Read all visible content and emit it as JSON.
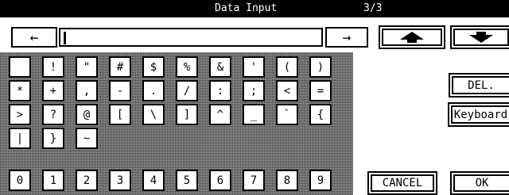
{
  "header": {
    "title": "Data Input",
    "page": "3/3"
  },
  "field": {
    "value": ""
  },
  "nav": {
    "left_arrow": "←",
    "right_arrow": "→"
  },
  "keys": {
    "row1": [
      " ",
      "!",
      "\"",
      "#",
      "$",
      "%",
      "&",
      "'",
      "(",
      ")"
    ],
    "row2": [
      "*",
      "+",
      ",",
      "-",
      ".",
      "/",
      ":",
      ";",
      "<",
      "="
    ],
    "row3": [
      ">",
      "?",
      "@",
      "[",
      "\\",
      "]",
      "^",
      "_",
      "`",
      "{"
    ],
    "row4": [
      "|",
      "}",
      "~"
    ],
    "row5": [
      "0",
      "1",
      "2",
      "3",
      "4",
      "5",
      "6",
      "7",
      "8",
      "9"
    ]
  },
  "buttons": {
    "del": "DEL.",
    "keyboard": "Keyboard",
    "cancel": "CANCEL",
    "ok": "OK"
  },
  "icons": {
    "up": "up-triangle-icon",
    "down": "down-triangle-icon"
  }
}
